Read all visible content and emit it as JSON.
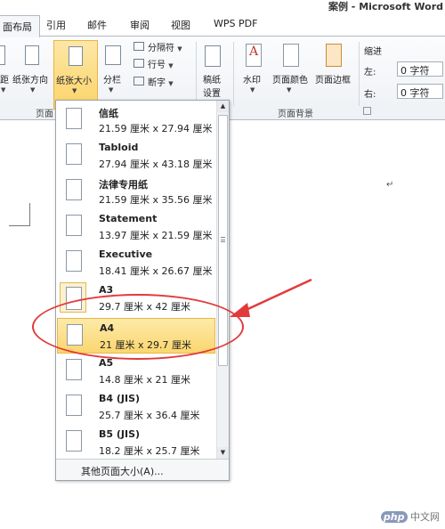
{
  "window": {
    "title": "案例 - Microsoft Word"
  },
  "tabs": [
    {
      "label": "面布局",
      "active": true
    },
    {
      "label": "引用"
    },
    {
      "label": "邮件"
    },
    {
      "label": "审阅"
    },
    {
      "label": "视图"
    },
    {
      "label": "WPS PDF"
    }
  ],
  "ribbon": {
    "margins_label": "距",
    "orientation_label": "纸张方向",
    "size_label": "纸张大小",
    "columns_label": "分栏",
    "breaks_label": "分隔符",
    "line_numbers_label": "行号",
    "hyphenation_label": "断字",
    "manuscript_label1": "稿纸",
    "manuscript_label2": "设置",
    "watermark_label": "水印",
    "page_color_label": "页面颜色",
    "page_borders_label": "页面边框",
    "indent_header": "缩进",
    "indent_left_label": "左:",
    "indent_left_value": "0 字符",
    "indent_right_label": "右:",
    "indent_right_value": "0 字符",
    "group_page_setup": "页面",
    "group_page_background": "页面背景"
  },
  "paper_sizes": [
    {
      "name": "信纸",
      "dims": "21.59 厘米 x 27.94 厘米"
    },
    {
      "name": "Tabloid",
      "dims": "27.94 厘米 x 43.18 厘米"
    },
    {
      "name": "法律专用纸",
      "dims": "21.59 厘米 x 35.56 厘米"
    },
    {
      "name": "Statement",
      "dims": "13.97 厘米 x 21.59 厘米"
    },
    {
      "name": "Executive",
      "dims": "18.41 厘米 x 26.67 厘米"
    },
    {
      "name": "A3",
      "dims": "29.7 厘米 x 42 厘米"
    },
    {
      "name": "A4",
      "dims": "21 厘米 x 29.7 厘米",
      "selected": true
    },
    {
      "name": "A5",
      "dims": "14.8 厘米 x 21 厘米"
    },
    {
      "name": "B4 (JIS)",
      "dims": "25.7 厘米 x 36.4 厘米"
    },
    {
      "name": "B5 (JIS)",
      "dims": "18.2 厘米 x 25.7 厘米"
    }
  ],
  "more_sizes_label": "其他页面大小(A)...",
  "watermark": {
    "brand": "php",
    "suffix": "中文网"
  },
  "colors": {
    "highlight": "#fbd66f",
    "annotation": "#e23a3a"
  }
}
